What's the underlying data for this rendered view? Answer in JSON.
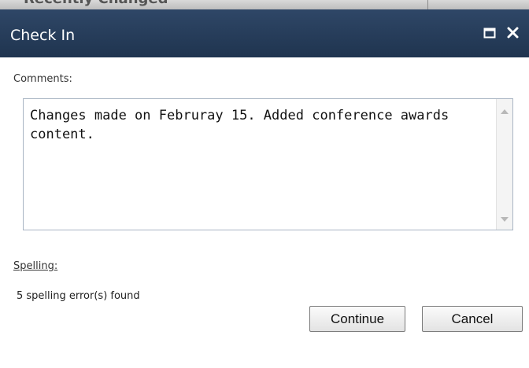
{
  "background_strip": {
    "text": "Recently Changed"
  },
  "dialog": {
    "title": "Check In",
    "title_bar_color": "#2a3f5d",
    "icons": [
      "maximize-icon",
      "close-icon"
    ]
  },
  "comments": {
    "label": "Comments:",
    "value": "Changes made on Februray 15. Added conference awards content."
  },
  "spelling": {
    "label": "Spelling:",
    "status": "5 spelling error(s) found"
  },
  "buttons": {
    "continue": "Continue",
    "cancel": "Cancel"
  }
}
